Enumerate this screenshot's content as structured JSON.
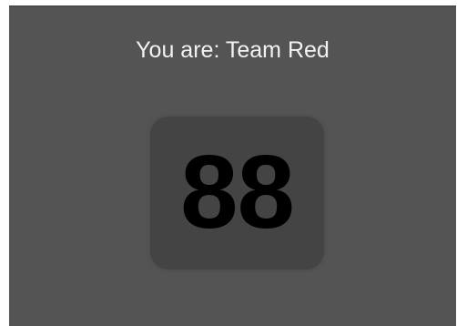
{
  "status": {
    "team_text": "You are: Team Red"
  },
  "counter": {
    "value": "88"
  },
  "colors": {
    "background": "#545454",
    "card": "#444444",
    "text": "#f2f2f2",
    "number": "#000000"
  }
}
